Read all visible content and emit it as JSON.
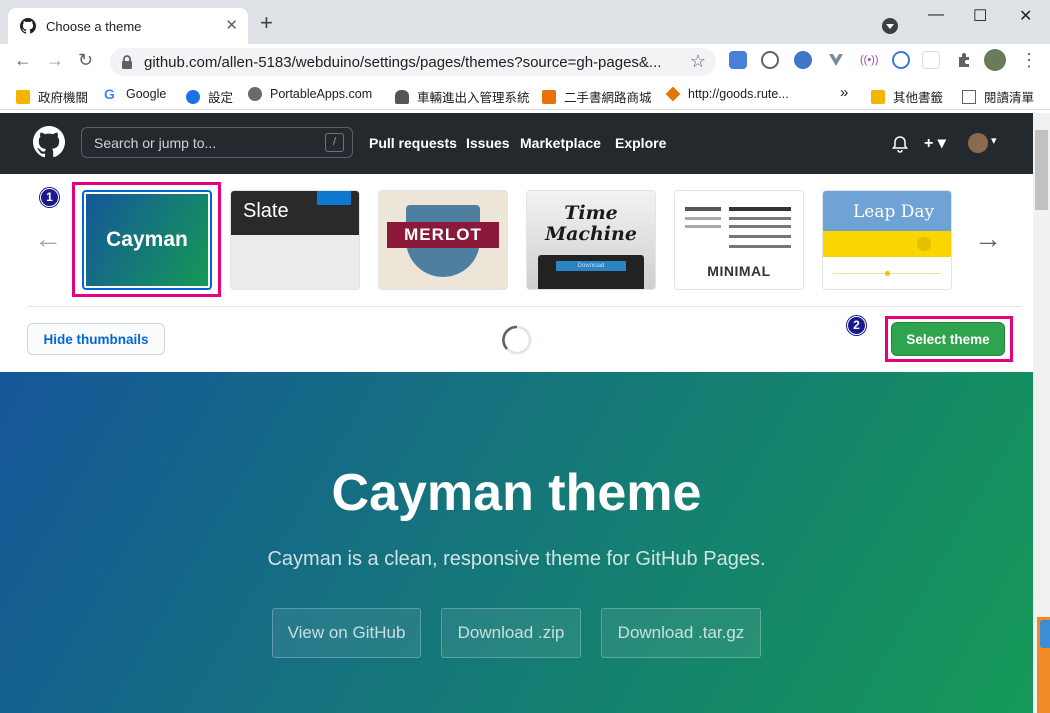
{
  "browser": {
    "tab_title": "Choose a theme",
    "close_glyph": "✕",
    "newtab_glyph": "+",
    "url": "github.com/allen-5183/webduino/settings/pages/themes?source=gh-pages&...",
    "window_controls": [
      "—",
      "☐",
      "✕"
    ],
    "nav_glyphs": {
      "back": "←",
      "forward": "→",
      "reload": "↻",
      "star": "☆",
      "menu": "⋮"
    }
  },
  "bookmarks": [
    {
      "label": "政府機關",
      "icon": "folder-icon"
    },
    {
      "label": "Google",
      "icon": "google-icon"
    },
    {
      "label": "設定",
      "icon": "gear-icon"
    },
    {
      "label": "PortableApps.com",
      "icon": "portableapps-icon"
    },
    {
      "label": "車輛進出入管理系統",
      "icon": "car-icon"
    },
    {
      "label": "二手書網路商城",
      "icon": "shop-icon"
    },
    {
      "label": "http://goods.rute...",
      "icon": "ruten-icon"
    },
    {
      "label": "»",
      "icon": ""
    },
    {
      "label": "其他書籤",
      "icon": "folder-icon"
    },
    {
      "label": "閱讀清單",
      "icon": "reading-list-icon"
    }
  ],
  "github": {
    "search_placeholder": "Search or jump to...",
    "slash_key": "/",
    "nav": [
      "Pull requests",
      "Issues",
      "Marketplace",
      "Explore"
    ],
    "plus_glyph": "+ ▾",
    "avatar_caret": "▾"
  },
  "theme_picker": {
    "themes": [
      "Cayman",
      "Slate",
      "MERLOT",
      "Time Machine",
      "MINIMAL",
      "Leap Day"
    ],
    "time_machine_button": "Download",
    "prev_glyph": "←",
    "next_glyph": "→",
    "hide_thumbnails": "Hide thumbnails",
    "select_theme": "Select theme",
    "step_badges": [
      "1",
      "2"
    ]
  },
  "hero": {
    "title": "Cayman theme",
    "subtitle": "Cayman is a clean, responsive theme for GitHub Pages.",
    "buttons": [
      "View on GitHub",
      "Download .zip",
      "Download .tar.gz"
    ]
  },
  "colors": {
    "accent_highlight": "#e6007e",
    "select_green": "#2ea44f",
    "hero_gradient_start": "#155799",
    "hero_gradient_end": "#159957",
    "github_header": "#24292e"
  }
}
